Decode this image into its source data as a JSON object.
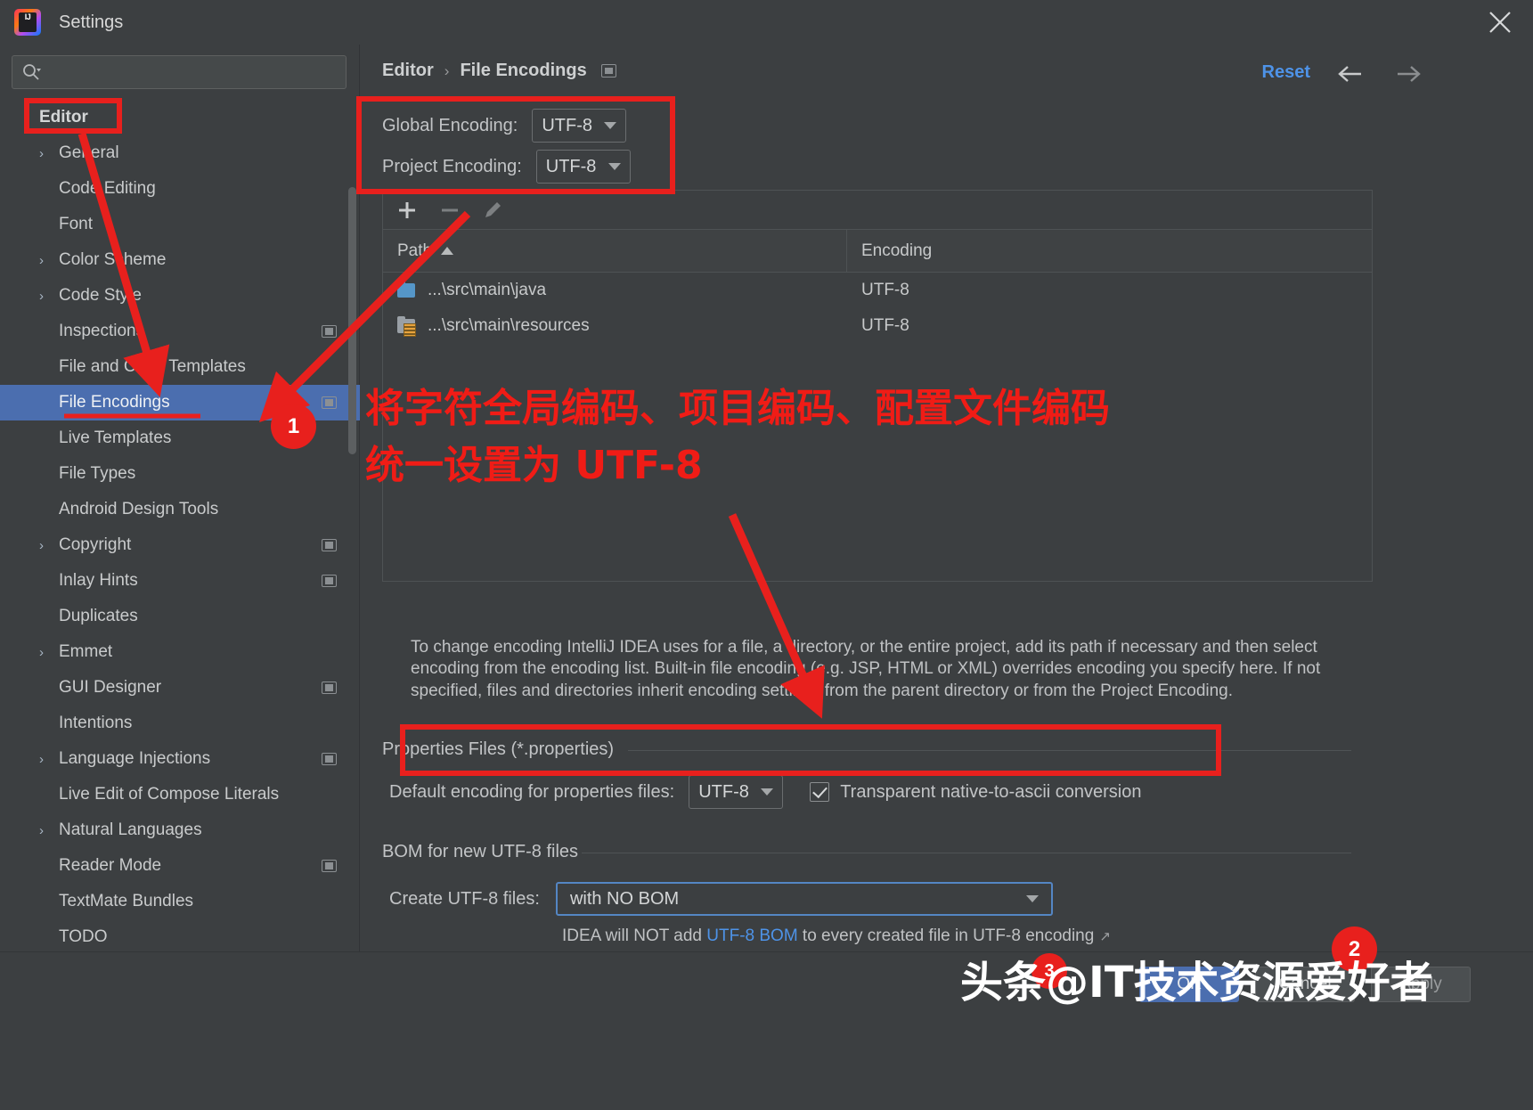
{
  "window": {
    "title": "Settings",
    "logo_line1": "IJ",
    "close_icon": "close-icon"
  },
  "search": {
    "placeholder": "",
    "value": "",
    "icon": "search-icon"
  },
  "sidebar": {
    "root_label": "Editor",
    "items": [
      {
        "label": "General",
        "expandable": true,
        "badge": false,
        "selected": false
      },
      {
        "label": "Code Editing",
        "expandable": false,
        "badge": false,
        "selected": false
      },
      {
        "label": "Font",
        "expandable": false,
        "badge": false,
        "selected": false
      },
      {
        "label": "Color Scheme",
        "expandable": true,
        "badge": false,
        "selected": false
      },
      {
        "label": "Code Style",
        "expandable": true,
        "badge": false,
        "selected": false
      },
      {
        "label": "Inspections",
        "expandable": false,
        "badge": true,
        "selected": false
      },
      {
        "label": "File and Code Templates",
        "expandable": false,
        "badge": false,
        "selected": false
      },
      {
        "label": "File Encodings",
        "expandable": false,
        "badge": true,
        "selected": true
      },
      {
        "label": "Live Templates",
        "expandable": false,
        "badge": false,
        "selected": false
      },
      {
        "label": "File Types",
        "expandable": false,
        "badge": false,
        "selected": false
      },
      {
        "label": "Android Design Tools",
        "expandable": false,
        "badge": false,
        "selected": false
      },
      {
        "label": "Copyright",
        "expandable": true,
        "badge": true,
        "selected": false
      },
      {
        "label": "Inlay Hints",
        "expandable": false,
        "badge": true,
        "selected": false
      },
      {
        "label": "Duplicates",
        "expandable": false,
        "badge": false,
        "selected": false
      },
      {
        "label": "Emmet",
        "expandable": true,
        "badge": false,
        "selected": false
      },
      {
        "label": "GUI Designer",
        "expandable": false,
        "badge": true,
        "selected": false
      },
      {
        "label": "Intentions",
        "expandable": false,
        "badge": false,
        "selected": false
      },
      {
        "label": "Language Injections",
        "expandable": true,
        "badge": true,
        "selected": false
      },
      {
        "label": "Live Edit of Compose Literals",
        "expandable": false,
        "badge": false,
        "selected": false
      },
      {
        "label": "Natural Languages",
        "expandable": true,
        "badge": false,
        "selected": false
      },
      {
        "label": "Reader Mode",
        "expandable": false,
        "badge": true,
        "selected": false
      },
      {
        "label": "TextMate Bundles",
        "expandable": false,
        "badge": false,
        "selected": false
      },
      {
        "label": "TODO",
        "expandable": false,
        "badge": false,
        "selected": false
      }
    ],
    "help_label": "?"
  },
  "header": {
    "breadcrumb_parent": "Editor",
    "breadcrumb_sep": "›",
    "breadcrumb_current": "File Encodings",
    "reset_label": "Reset",
    "back_icon": "arrow-left-icon",
    "forward_icon": "arrow-right-icon"
  },
  "encodings": {
    "global_label": "Global Encoding:",
    "global_value": "UTF-8",
    "project_label": "Project Encoding:",
    "project_value": "UTF-8"
  },
  "table": {
    "toolbar": {
      "add": "+",
      "remove": "−",
      "edit": "pencil-icon"
    },
    "columns": [
      "Path",
      "Encoding"
    ],
    "sort_column": "Path",
    "sort_direction": "asc",
    "rows": [
      {
        "path": "...\\src\\main\\java",
        "encoding": "UTF-8",
        "icon": "folder-source-icon"
      },
      {
        "path": "...\\src\\main\\resources",
        "encoding": "UTF-8",
        "icon": "folder-resources-icon"
      }
    ]
  },
  "description": "To change encoding IntelliJ IDEA uses for a file, a directory, or the entire project, add its path if necessary and then select encoding from the encoding list. Built-in file encoding (e.g. JSP, HTML or XML) overrides encoding you specify here. If not specified, files and directories inherit encoding settings from the parent directory or from the Project Encoding.",
  "properties_section": {
    "title": "Properties Files (*.properties)",
    "default_encoding_label": "Default encoding for properties files:",
    "default_encoding_value": "UTF-8",
    "transparent_label": "Transparent native-to-ascii conversion",
    "transparent_checked": true
  },
  "bom_section": {
    "title": "BOM for new UTF-8 files",
    "create_label": "Create UTF-8 files:",
    "create_value": "with NO BOM",
    "note_prefix": "IDEA will NOT add ",
    "note_link": "UTF-8 BOM",
    "note_suffix": " to every created file in UTF-8 encoding",
    "ext_arrow": "↗"
  },
  "footer": {
    "ok": "OK",
    "cancel": "Cancel",
    "apply": "Apply"
  },
  "annotations": {
    "cn_line1": "将字符全局编码、项目编码、配置文件编码",
    "cn_line2": "统一设置为 UTF-8",
    "badge1": "1",
    "badge2": "2",
    "badge3": "3",
    "accent_color": "#e8201d"
  },
  "watermark": {
    "text": "头条@IT技术资源爱好者"
  }
}
